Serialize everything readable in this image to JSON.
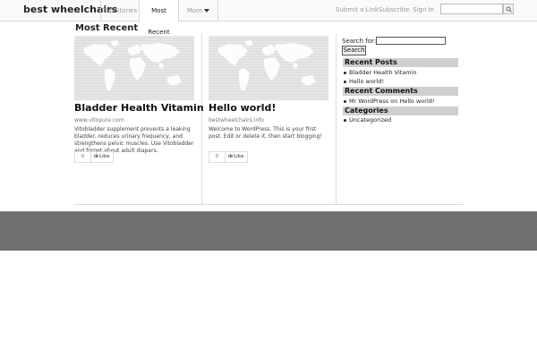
{
  "header": {
    "site_title": "best wheelchairs",
    "tabs": [
      {
        "label": "Top Stories"
      },
      {
        "label": "Most Recent"
      },
      {
        "label": "More"
      }
    ],
    "links": {
      "submit": "Submit a Link",
      "subscribe": "Subscribe",
      "sign_in": "Sign In"
    },
    "search": {
      "value": ""
    }
  },
  "main": {
    "section_title": "Most Recent",
    "posts": [
      {
        "title": "Bladder Health Vitamin",
        "source": "www.vitopure.com",
        "excerpt": "Vitobladder supplement prevents a leaking bladder, reduces urinary frequency, and strengthens pelvic muscles. Use Vitobladder and forget about adult diapers.",
        "like_count": "0",
        "like_label": "Like"
      },
      {
        "title": "Hello world!",
        "source": "bestwheelchairs.info",
        "excerpt": "Welcome to WordPress. This is your first post. Edit or delete it, then start blogging!",
        "like_count": "0",
        "like_label": "Like"
      }
    ]
  },
  "sidebar": {
    "search_label": "Search for:",
    "search_value": "",
    "search_button": "Search",
    "recent_posts_heading": "Recent Posts",
    "recent_posts": [
      "Bladder Health Vitamin",
      "Hello world!"
    ],
    "recent_comments_heading": "Recent Comments",
    "recent_comment": {
      "author": "Mr WordPress",
      "on": "on",
      "post": "Hello world!"
    },
    "categories_heading": "Categories",
    "categories": [
      "Uncategorized"
    ]
  },
  "icons": {
    "search": "search-icon",
    "more": "caret-down-icon",
    "like": "thumbs-up-icon",
    "thumbnail": "world-map-image"
  },
  "colors": {
    "footer": "#6f6f6f",
    "sidebar_heading": "#cfcfcf",
    "topbar": "#fafafa"
  }
}
